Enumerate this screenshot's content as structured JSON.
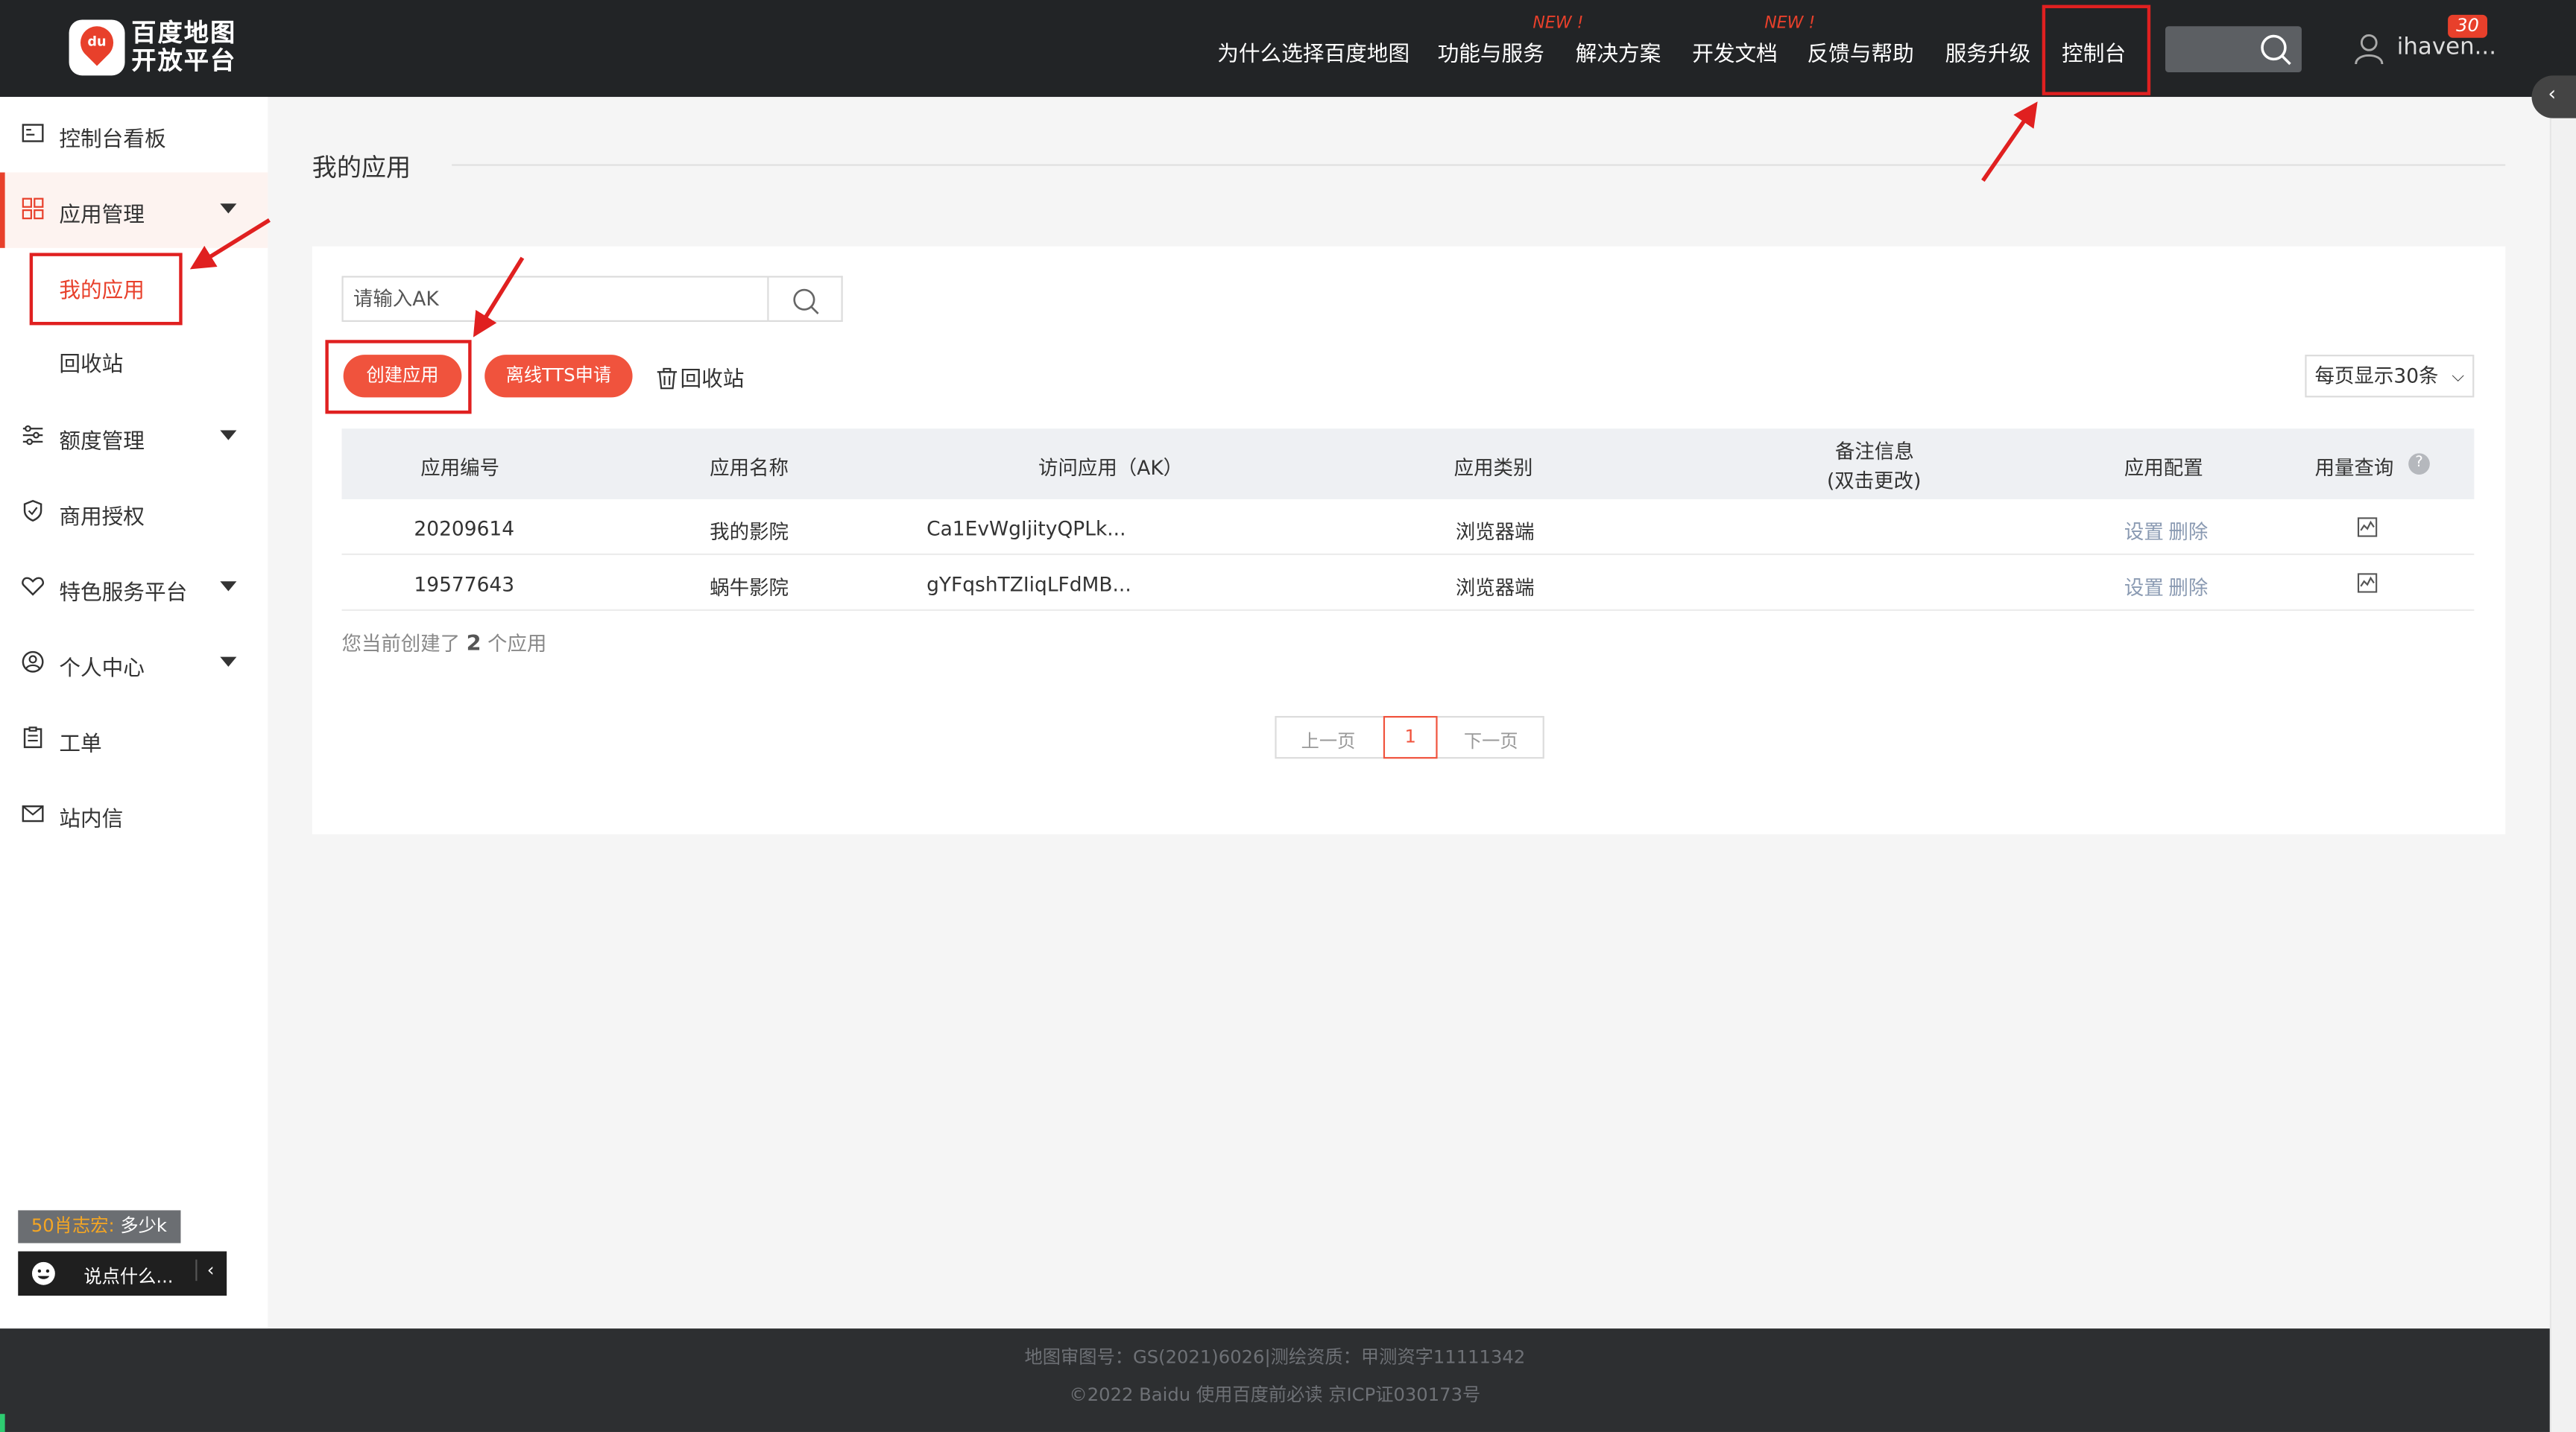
{
  "brand": {
    "logo_line1": "百度地图",
    "logo_line2": "开放平台",
    "logo_mark": "du",
    "accent_color": "#e8402b"
  },
  "topnav": {
    "items": [
      {
        "label": "为什么选择百度地图",
        "new": ""
      },
      {
        "label": "功能与服务",
        "new": "NEW !"
      },
      {
        "label": "解决方案",
        "new": ""
      },
      {
        "label": "开发文档",
        "new": "NEW !"
      },
      {
        "label": "反馈与帮助",
        "new": ""
      },
      {
        "label": "服务升级",
        "new": ""
      },
      {
        "label": "控制台",
        "new": ""
      }
    ],
    "user_name": "ihaven...",
    "notification_count": "30"
  },
  "sidebar": {
    "items": [
      {
        "label": "控制台看板",
        "icon": "dashboard-icon"
      },
      {
        "label": "应用管理",
        "icon": "grid-icon"
      },
      {
        "label": "额度管理",
        "icon": "sliders-icon"
      },
      {
        "label": "商用授权",
        "icon": "shield-icon"
      },
      {
        "label": "特色服务平台",
        "icon": "heart-icon"
      },
      {
        "label": "个人中心",
        "icon": "user-circle-icon"
      },
      {
        "label": "工单",
        "icon": "clipboard-icon"
      },
      {
        "label": "站内信",
        "icon": "mail-icon"
      }
    ],
    "app_sub": [
      {
        "label": "我的应用"
      },
      {
        "label": "回收站"
      }
    ],
    "promo_highlight": "50肖志宏:",
    "promo_text": "多少k",
    "say_placeholder": "说点什么..."
  },
  "main": {
    "page_title": "我的应用",
    "search_placeholder": "请输入AK",
    "create_label": "创建应用",
    "tts_label": "离线TTS申请",
    "recycle_label": "回收站",
    "page_size_label": "每页显示30条",
    "columns": [
      "应用编号",
      "应用名称",
      "访问应用（AK）",
      "应用类别",
      "备注信息",
      "(双击更改)",
      "应用配置",
      "用量查询"
    ],
    "rows": [
      {
        "id": "20209614",
        "name": "我的影院",
        "ak": "Ca1EvWgIjityQPLk...",
        "type": "浏览器端",
        "note": "",
        "settings": "设置",
        "delete": "删除"
      },
      {
        "id": "19577643",
        "name": "蜗牛影院",
        "ak": "gYFqshTZIiqLFdMB...",
        "type": "浏览器端",
        "note": "",
        "settings": "设置",
        "delete": "删除"
      }
    ],
    "summary_prefix": "您当前创建了",
    "summary_count": "2",
    "summary_suffix": "个应用",
    "pager": {
      "prev": "上一页",
      "current": "1",
      "next": "下一页"
    }
  },
  "footer": {
    "line1": "地图审图号：GS(2021)6026|测绘资质：甲测资字11111342",
    "line2": "©2022 Baidu 使用百度前必读 京ICP证030173号"
  }
}
